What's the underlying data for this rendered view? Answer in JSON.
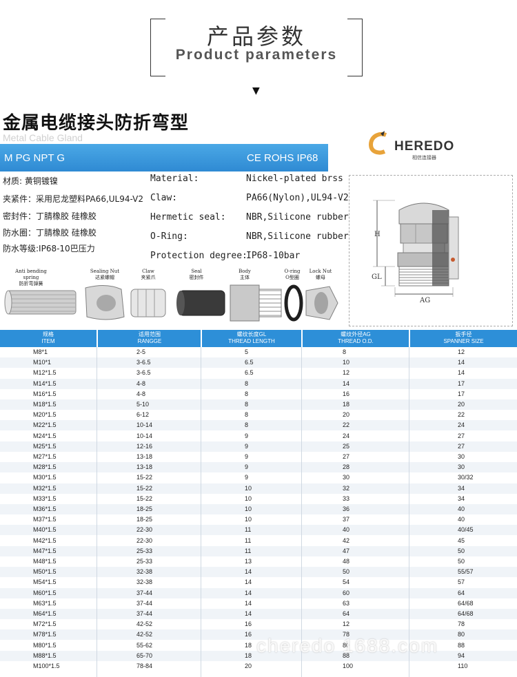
{
  "header": {
    "title_zh": "产品参数",
    "title_en": "Product parameters"
  },
  "title": {
    "zh": "金属电缆接头防折弯型",
    "en": "Metal Cable Gland"
  },
  "banner": {
    "left": "M PG NPT G",
    "right": "CE  ROHS  IP68"
  },
  "logo": {
    "text": "HEREDO",
    "sub": "相信连接器"
  },
  "specs_zh": [
    "材质:   黄铜镀镍",
    "夹紧件：采用尼龙塑料PA66,UL94-V2",
    "密封件：丁腈橡胶 硅橡胶",
    "防水圈：丁腈橡胶 硅橡胶",
    "防水等级:IP68-10巴压力"
  ],
  "specs_en": [
    {
      "k": "Material:",
      "v": "Nickel-plated brss"
    },
    {
      "k": "Claw:",
      "v": "PA66(Nylon),UL94-V2"
    },
    {
      "k": "Hermetic seal:",
      "v": "NBR,Silicone rubber"
    },
    {
      "k": "O-Ring:",
      "v": "NBR,Silicone rubber"
    },
    {
      "k": "Protection degree:",
      "v": "IP68-10bar"
    }
  ],
  "diagram_labels": {
    "h": "H",
    "gl": "GL",
    "ag": "AG"
  },
  "parts": [
    {
      "en": "Anti bending spring",
      "zh": "防折弯弹簧"
    },
    {
      "en": "Sealing Nut",
      "zh": "达紧螺帽"
    },
    {
      "en": "Claw",
      "zh": "夹紧爪"
    },
    {
      "en": "Seal",
      "zh": "密封件"
    },
    {
      "en": "Body",
      "zh": "主体"
    },
    {
      "en": "O-ring",
      "zh": "O型圈"
    },
    {
      "en": "Lock Nut",
      "zh": "螺母"
    }
  ],
  "table": {
    "headers": [
      {
        "zh": "规格",
        "en": "ITEM"
      },
      {
        "zh": "适用范围",
        "en": "RANGGE"
      },
      {
        "zh": "螺纹长度GL",
        "en": "THREAD LENGTH"
      },
      {
        "zh": "螺纹外径AG",
        "en": "THREAD O.D."
      },
      {
        "zh": "扳手径",
        "en": "SPANNER SIZE"
      }
    ],
    "rows": [
      [
        "M8*1",
        "2-5",
        "5",
        "8",
        "12"
      ],
      [
        "M10*1",
        "3-6.5",
        "6.5",
        "10",
        "14"
      ],
      [
        "M12*1.5",
        "3-6.5",
        "6.5",
        "12",
        "14"
      ],
      [
        "M14*1.5",
        "4-8",
        "8",
        "14",
        "17"
      ],
      [
        "M16*1.5",
        "4-8",
        "8",
        "16",
        "17"
      ],
      [
        "M18*1.5",
        "5-10",
        "8",
        "18",
        "20"
      ],
      [
        "M20*1.5",
        "6-12",
        "8",
        "20",
        "22"
      ],
      [
        "M22*1.5",
        "10-14",
        "8",
        "22",
        "24"
      ],
      [
        "M24*1.5",
        "10-14",
        "9",
        "24",
        "27"
      ],
      [
        "M25*1.5",
        "12-16",
        "9",
        "25",
        "27"
      ],
      [
        "M27*1.5",
        "13-18",
        "9",
        "27",
        "30"
      ],
      [
        "M28*1.5",
        "13-18",
        "9",
        "28",
        "30"
      ],
      [
        "M30*1.5",
        "15-22",
        "9",
        "30",
        "30/32"
      ],
      [
        "M32*1.5",
        "15-22",
        "10",
        "32",
        "34"
      ],
      [
        "M33*1.5",
        "15-22",
        "10",
        "33",
        "34"
      ],
      [
        "M36*1.5",
        "18-25",
        "10",
        "36",
        "40"
      ],
      [
        "M37*1.5",
        "18-25",
        "10",
        "37",
        "40"
      ],
      [
        "M40*1.5",
        "22-30",
        "11",
        "40",
        "40/45"
      ],
      [
        "M42*1.5",
        "22-30",
        "11",
        "42",
        "45"
      ],
      [
        "M47*1.5",
        "25-33",
        "11",
        "47",
        "50"
      ],
      [
        "M48*1.5",
        "25-33",
        "13",
        "48",
        "50"
      ],
      [
        "M50*1.5",
        "32-38",
        "14",
        "50",
        "55/57"
      ],
      [
        "M54*1.5",
        "32-38",
        "14",
        "54",
        "57"
      ],
      [
        "M60*1.5",
        "37-44",
        "14",
        "60",
        "64"
      ],
      [
        "M63*1.5",
        "37-44",
        "14",
        "63",
        "64/68"
      ],
      [
        "M64*1.5",
        "37-44",
        "14",
        "64",
        "64/68"
      ],
      [
        "M72*1.5",
        "42-52",
        "16",
        "12",
        "78"
      ],
      [
        "M78*1.5",
        "42-52",
        "16",
        "78",
        "80"
      ],
      [
        "M80*1.5",
        "55-62",
        "18",
        "80",
        "88"
      ],
      [
        "M88*1.5",
        "65-70",
        "18",
        "88",
        "94"
      ],
      [
        "M100*1.5",
        "78-84",
        "20",
        "100",
        "110"
      ]
    ]
  },
  "watermark": "cheredo 1688.com",
  "colors": {
    "banner": "#2f8ad3",
    "table_header": "#2d8fd8",
    "logo_orange": "#e8a33a"
  }
}
